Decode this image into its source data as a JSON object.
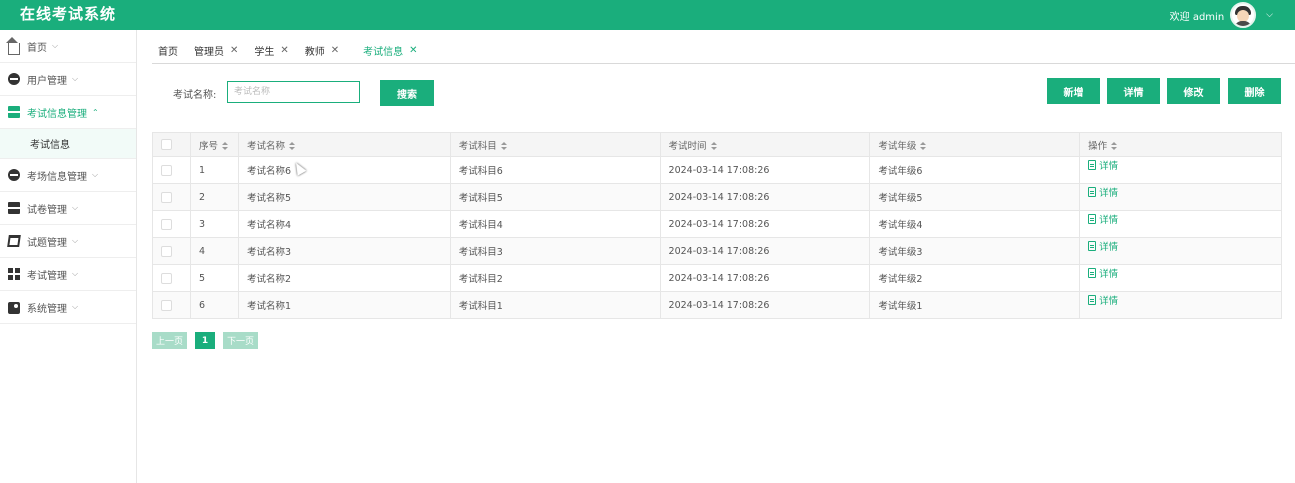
{
  "app": {
    "title": "在线考试系统"
  },
  "user": {
    "greeting": "欢迎 admin",
    "chevron": "⌵"
  },
  "sidebar": {
    "items": [
      {
        "label": "首页",
        "icon": "home-icon",
        "arrow": "⌵"
      },
      {
        "label": "用户管理",
        "icon": "user-group-icon",
        "arrow": "⌵"
      },
      {
        "label": "考试信息管理",
        "icon": "server-icon",
        "arrow": "⌃",
        "active": true,
        "children": [
          {
            "label": "考试信息"
          }
        ]
      },
      {
        "label": "考场信息管理",
        "icon": "room-icon",
        "arrow": "⌵"
      },
      {
        "label": "试卷管理",
        "icon": "paper-icon",
        "arrow": "⌵"
      },
      {
        "label": "试题管理",
        "icon": "question-icon",
        "arrow": "⌵"
      },
      {
        "label": "考试管理",
        "icon": "grid-icon",
        "arrow": "⌵"
      },
      {
        "label": "系统管理",
        "icon": "settings-icon",
        "arrow": "⌵"
      }
    ]
  },
  "tabs": [
    {
      "label": "首页",
      "closable": false
    },
    {
      "label": "管理员",
      "closable": true
    },
    {
      "label": "学生",
      "closable": true
    },
    {
      "label": "教师",
      "closable": true
    },
    {
      "label": "考试信息",
      "closable": true,
      "active": true
    }
  ],
  "tab_close": "✕",
  "search": {
    "label": "考试名称:",
    "placeholder": "考试名称",
    "value": "",
    "button": "搜索"
  },
  "actions": {
    "add": "新增",
    "detail": "详情",
    "edit": "修改",
    "delete": "删除"
  },
  "table": {
    "columns": [
      "序号",
      "考试名称",
      "考试科目",
      "考试时间",
      "考试年级",
      "操作"
    ],
    "rows": [
      {
        "index": "1",
        "name": "考试名称6",
        "subject": "考试科目6",
        "time": "2024-03-14 17:08:26",
        "grade": "考试年级6",
        "op": "详情"
      },
      {
        "index": "2",
        "name": "考试名称5",
        "subject": "考试科目5",
        "time": "2024-03-14 17:08:26",
        "grade": "考试年级5",
        "op": "详情"
      },
      {
        "index": "3",
        "name": "考试名称4",
        "subject": "考试科目4",
        "time": "2024-03-14 17:08:26",
        "grade": "考试年级4",
        "op": "详情"
      },
      {
        "index": "4",
        "name": "考试名称3",
        "subject": "考试科目3",
        "time": "2024-03-14 17:08:26",
        "grade": "考试年级3",
        "op": "详情"
      },
      {
        "index": "5",
        "name": "考试名称2",
        "subject": "考试科目2",
        "time": "2024-03-14 17:08:26",
        "grade": "考试年级2",
        "op": "详情"
      },
      {
        "index": "6",
        "name": "考试名称1",
        "subject": "考试科目1",
        "time": "2024-03-14 17:08:26",
        "grade": "考试年级1",
        "op": "详情"
      }
    ]
  },
  "pager": {
    "prev": "上一页",
    "current": "1",
    "next": "下一页"
  },
  "colors": {
    "accent": "#1aae7c",
    "accent_disabled": "#a8dcc8"
  }
}
